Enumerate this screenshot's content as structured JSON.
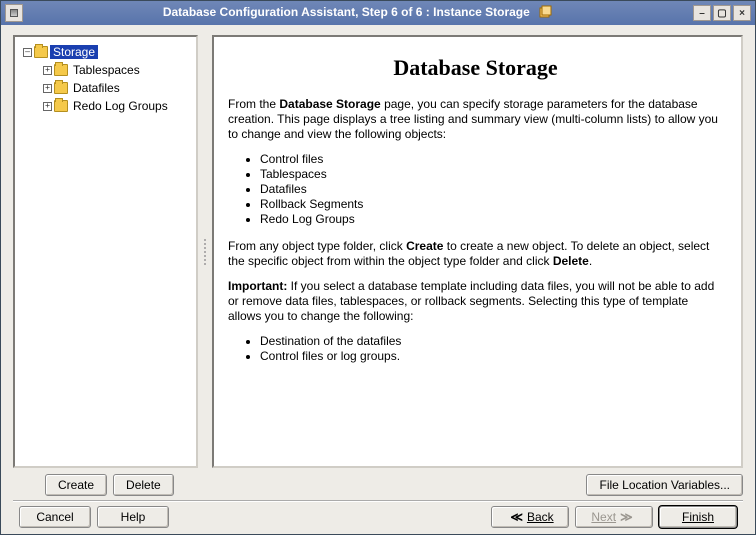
{
  "window": {
    "title": "Database Configuration Assistant, Step 6 of 6 : Instance Storage"
  },
  "tree": {
    "root": {
      "label": "Storage",
      "expanded": true,
      "selected": true
    },
    "children": [
      {
        "label": "Tablespaces"
      },
      {
        "label": "Datafiles"
      },
      {
        "label": "Redo Log Groups"
      }
    ]
  },
  "page": {
    "heading": "Database Storage",
    "intro_before": "From the ",
    "intro_bold": "Database Storage",
    "intro_after": " page, you can specify storage parameters for the database creation. This page displays a tree listing and summary view (multi-column lists) to allow you to change and view the following objects:",
    "bullets1": [
      "Control files",
      "Tablespaces",
      "Datafiles",
      "Rollback Segments",
      "Redo Log Groups"
    ],
    "para2_before": "From any object type folder, click ",
    "para2_bold1": "Create",
    "para2_mid": " to create a new object. To delete an object, select the specific object from within the object type folder and click ",
    "para2_bold2": "Delete",
    "para2_end": ".",
    "important_label": "Important:",
    "important_text": " If you select a database template including data files, you will not be able to add or remove data files, tablespaces, or rollback segments. Selecting this type of template allows you to change the following:",
    "bullets2": [
      "Destination of the datafiles",
      "Control files or log groups."
    ]
  },
  "buttons": {
    "create": "Create",
    "delete": "Delete",
    "fileloc": "File Location Variables...",
    "cancel": "Cancel",
    "help": "Help",
    "back": "Back",
    "back_marker": "≪",
    "next": "Next",
    "next_marker": "≫",
    "finish": "Finish"
  }
}
